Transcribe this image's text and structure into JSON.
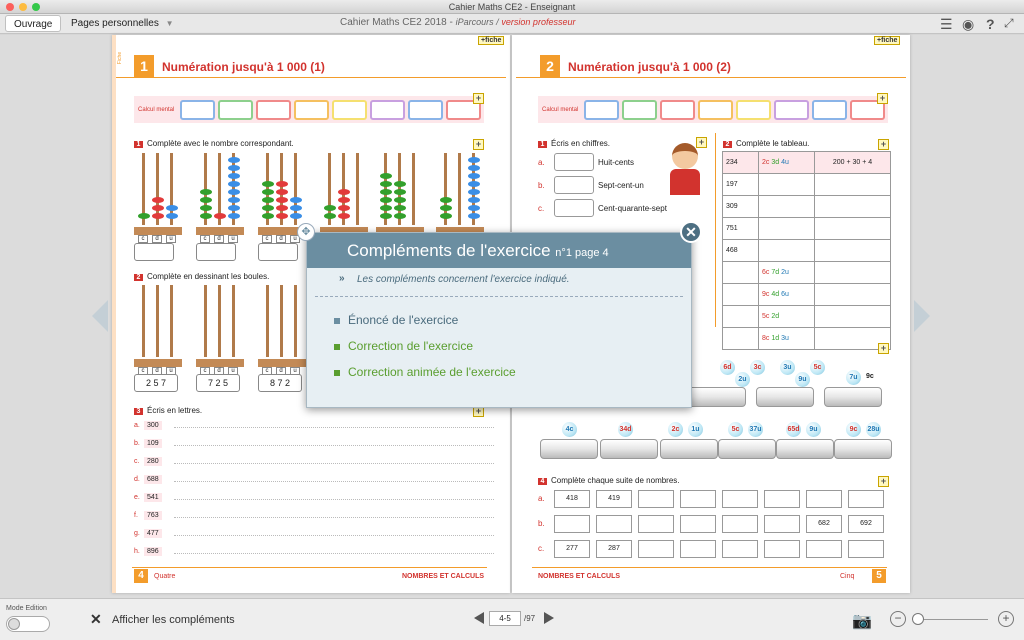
{
  "window": {
    "title": "Cahier Maths CE2 - Enseignant"
  },
  "toolbar": {
    "tab_ouvrage": "Ouvrage",
    "tab_pages": "Pages personnelles",
    "doc_title": "Cahier Maths CE2 2018",
    "doc_parcours": "iParcours /",
    "doc_version": "version professeur"
  },
  "left_page": {
    "side_label": "Fiche",
    "number": "1",
    "title": "Numération jusqu'à 1 000 (1)",
    "fiche_label": "fiche",
    "calcul_mental": "Calcul mental",
    "ex1": {
      "num": "1",
      "label": "Complète avec le nombre correspondant.",
      "cols": [
        "c",
        "d",
        "u"
      ]
    },
    "ex2": {
      "num": "2",
      "label": "Complète en dessinant les boules.",
      "answers": [
        "2 5 7",
        "7 2 5",
        "8 7 2"
      ]
    },
    "ex3": {
      "num": "3",
      "label": "Écris en lettres.",
      "rows": [
        {
          "letter": "a.",
          "value": "300"
        },
        {
          "letter": "b.",
          "value": "109"
        },
        {
          "letter": "c.",
          "value": "280"
        },
        {
          "letter": "d.",
          "value": "688"
        },
        {
          "letter": "e.",
          "value": "541"
        },
        {
          "letter": "f.",
          "value": "763"
        },
        {
          "letter": "g.",
          "value": "477"
        },
        {
          "letter": "h.",
          "value": "896"
        }
      ]
    },
    "footer_num": "4",
    "footer_word": "Quatre",
    "footer_section": "NOMBRES ET CALCULS"
  },
  "right_page": {
    "number": "2",
    "title": "Numération jusqu'à 1 000 (2)",
    "fiche_label": "fiche",
    "calcul_mental": "Calcul mental",
    "ex1": {
      "num": "1",
      "label": "Écris en chiffres.",
      "rows": [
        {
          "letter": "a.",
          "text": "Huit-cents"
        },
        {
          "letter": "b.",
          "text": "Sept-cent-un"
        },
        {
          "letter": "c.",
          "text": "Cent-quarante-sept"
        }
      ]
    },
    "ex2": {
      "num": "2",
      "label": "Complète le tableau.",
      "headers": {
        "h1": "234",
        "h2a": "2c",
        "h2b": "3d",
        "h2c": "4u",
        "h3": "200 + 30 + 4"
      },
      "col1": [
        "197",
        "309",
        "751",
        "468"
      ],
      "col2": [
        {
          "c": "6c",
          "d": "7d",
          "u": "2u"
        },
        {
          "c": "9c",
          "d": "4d",
          "u": "6u"
        },
        {
          "c": "5c",
          "d": "2d",
          "u": ""
        },
        {
          "c": "8c",
          "d": "1d",
          "u": "3u"
        }
      ]
    },
    "balls_row1": [
      "6d",
      "3c",
      "2u",
      "3u",
      "5c",
      "9u",
      "7u",
      "9c"
    ],
    "balls_row2": [
      "4c",
      "34d",
      "2c",
      "1u",
      "5c",
      "37u",
      "65d",
      "9u",
      "9c",
      "28u"
    ],
    "ex4": {
      "num": "4",
      "label": "Complète chaque suite de nombres.",
      "rows": [
        {
          "letter": "a.",
          "cells": [
            "418",
            "419",
            "",
            "",
            "",
            "",
            "",
            ""
          ]
        },
        {
          "letter": "b.",
          "cells": [
            "",
            "",
            "",
            "",
            "",
            "",
            "682",
            "692"
          ]
        },
        {
          "letter": "c.",
          "cells": [
            "277",
            "287",
            "",
            "",
            "",
            "",
            "",
            ""
          ]
        }
      ]
    },
    "footer_section": "NOMBRES ET CALCULS",
    "footer_word": "Cinq",
    "footer_num": "5"
  },
  "popup": {
    "title": "Compléments de l'exercice",
    "subtitle": "n°1 page 4",
    "note": "Les compléments concernent l'exercice indiqué.",
    "items": [
      "Énoncé de l'exercice",
      "Correction de l'exercice",
      "Correction animée de l'exercice"
    ],
    "close": "✕"
  },
  "bottom": {
    "mode_label": "Mode Edition",
    "show_complements": "Afficher les compléments",
    "page_input": "4-5",
    "page_total": "/97"
  },
  "colors": {
    "accent_orange": "#f39c2b",
    "title_red": "#d2332e",
    "popup_header": "#6b8ea1",
    "link_green": "#5a9e2f"
  }
}
